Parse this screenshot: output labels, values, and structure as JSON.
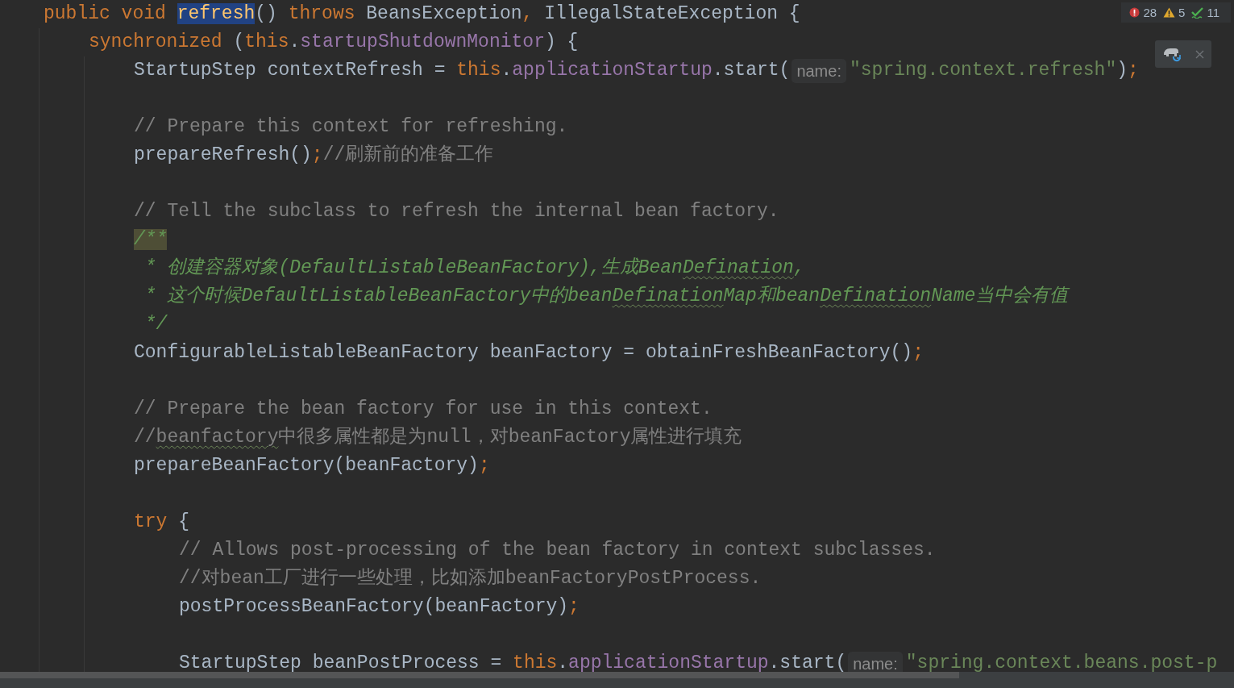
{
  "editor": {
    "lines": [
      {
        "kind": "code",
        "tokens": [
          {
            "kind": "kw",
            "text": "public void "
          },
          {
            "kind": "selected",
            "text": "refresh"
          },
          {
            "kind": "plain",
            "text": "() "
          },
          {
            "kind": "kw",
            "text": "throws "
          },
          {
            "kind": "plain",
            "text": "BeansException"
          },
          {
            "kind": "punct",
            "text": ", "
          },
          {
            "kind": "plain",
            "text": "IllegalStateException {"
          }
        ],
        "children": [
          {
            "kind": "code",
            "tokens": [
              {
                "kind": "kw",
                "text": "synchronized "
              },
              {
                "kind": "plain",
                "text": "("
              },
              {
                "kind": "kw",
                "text": "this"
              },
              {
                "kind": "plain",
                "text": "."
              },
              {
                "kind": "field",
                "text": "startupShutdownMonitor"
              },
              {
                "kind": "plain",
                "text": ") {"
              }
            ],
            "children": [
              {
                "kind": "code",
                "tokens": [
                  {
                    "kind": "plain",
                    "text": "StartupStep contextRefresh = "
                  },
                  {
                    "kind": "kw",
                    "text": "this"
                  },
                  {
                    "kind": "plain",
                    "text": "."
                  },
                  {
                    "kind": "field",
                    "text": "applicationStartup"
                  },
                  {
                    "kind": "plain",
                    "text": ".start("
                  },
                  {
                    "kind": "hint",
                    "text": "name:"
                  },
                  {
                    "kind": "str",
                    "text": "\"spring.context.refresh\""
                  },
                  {
                    "kind": "plain",
                    "text": ")"
                  },
                  {
                    "kind": "punct",
                    "text": ";"
                  }
                ]
              },
              {
                "kind": "blank"
              },
              {
                "kind": "code",
                "tokens": [
                  {
                    "kind": "comment",
                    "text": "// Prepare this context for refreshing."
                  }
                ]
              },
              {
                "kind": "code",
                "tokens": [
                  {
                    "kind": "plain",
                    "text": "prepareRefresh()"
                  },
                  {
                    "kind": "punct",
                    "text": ";"
                  },
                  {
                    "kind": "comment",
                    "text": "//刷新前的准备工作"
                  }
                ]
              },
              {
                "kind": "blank"
              },
              {
                "kind": "code",
                "tokens": [
                  {
                    "kind": "comment",
                    "text": "// Tell the subclass to refresh the internal bean factory."
                  }
                ]
              },
              {
                "kind": "code",
                "tokens": [
                  {
                    "kind": "docmark",
                    "text": "/**"
                  }
                ]
              },
              {
                "kind": "code",
                "tokens": [
                  {
                    "kind": "doc",
                    "text": " * 创建容器对象(DefaultListableBeanFactory),生成Bean"
                  },
                  {
                    "kind": "doctypo",
                    "text": "Defination"
                  },
                  {
                    "kind": "doc",
                    "text": ","
                  }
                ]
              },
              {
                "kind": "code",
                "tokens": [
                  {
                    "kind": "doc",
                    "text": " * 这个时候DefaultListableBeanFactory中的bean"
                  },
                  {
                    "kind": "doctypo",
                    "text": "Defination"
                  },
                  {
                    "kind": "doc",
                    "text": "Map和bean"
                  },
                  {
                    "kind": "doctypo",
                    "text": "Defination"
                  },
                  {
                    "kind": "doc",
                    "text": "Name当中会有值"
                  }
                ]
              },
              {
                "kind": "code",
                "tokens": [
                  {
                    "kind": "doc",
                    "text": " */"
                  }
                ]
              },
              {
                "kind": "code",
                "tokens": [
                  {
                    "kind": "plain",
                    "text": "ConfigurableListableBeanFactory beanFactory = obtainFreshBeanFactory()"
                  },
                  {
                    "kind": "punct",
                    "text": ";"
                  }
                ]
              },
              {
                "kind": "blank"
              },
              {
                "kind": "code",
                "tokens": [
                  {
                    "kind": "comment",
                    "text": "// Prepare the bean factory for use in this context."
                  }
                ]
              },
              {
                "kind": "code",
                "tokens": [
                  {
                    "kind": "comment",
                    "text": "//"
                  },
                  {
                    "kind": "typo",
                    "text": "beanfactory"
                  },
                  {
                    "kind": "comment",
                    "text": "中很多属性都是为null，对beanFactory属性进行填充"
                  }
                ]
              },
              {
                "kind": "code",
                "tokens": [
                  {
                    "kind": "plain",
                    "text": "prepareBeanFactory(beanFactory)"
                  },
                  {
                    "kind": "punct",
                    "text": ";"
                  }
                ]
              },
              {
                "kind": "blank"
              },
              {
                "kind": "code",
                "tokens": [
                  {
                    "kind": "kw",
                    "text": "try "
                  },
                  {
                    "kind": "plain",
                    "text": "{"
                  }
                ],
                "children": [
                  {
                    "kind": "code",
                    "tokens": [
                      {
                        "kind": "comment",
                        "text": "// Allows post-processing of the bean factory in context subclasses."
                      }
                    ]
                  },
                  {
                    "kind": "code",
                    "tokens": [
                      {
                        "kind": "comment",
                        "text": "//对bean工厂进行一些处理，比如添加beanFactoryPostProcess."
                      }
                    ]
                  },
                  {
                    "kind": "code",
                    "tokens": [
                      {
                        "kind": "plain",
                        "text": "postProcessBeanFactory(beanFactory)"
                      },
                      {
                        "kind": "punct",
                        "text": ";"
                      }
                    ]
                  },
                  {
                    "kind": "blank"
                  },
                  {
                    "kind": "code",
                    "tokens": [
                      {
                        "kind": "plain",
                        "text": "StartupStep beanPostProcess = "
                      },
                      {
                        "kind": "kw",
                        "text": "this"
                      },
                      {
                        "kind": "plain",
                        "text": "."
                      },
                      {
                        "kind": "field",
                        "text": "applicationStartup"
                      },
                      {
                        "kind": "plain",
                        "text": ".start("
                      },
                      {
                        "kind": "hint",
                        "text": "name:"
                      },
                      {
                        "kind": "str",
                        "text": "\"spring.context.beans.post-p"
                      }
                    ]
                  }
                ]
              }
            ]
          }
        ]
      }
    ]
  },
  "inspections": {
    "errors": "28",
    "warnings": "5",
    "typos": "11"
  }
}
